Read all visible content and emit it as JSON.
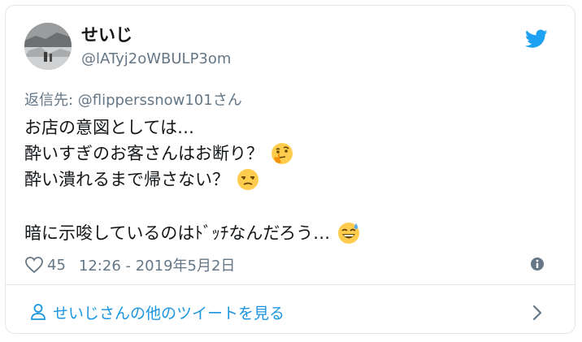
{
  "tweet": {
    "author": {
      "display_name": "せいじ",
      "handle": "@lATyj2oWBULP3om"
    },
    "reply_to": "返信先: @flipperssnow101さん",
    "lines": [
      "お店の意図としては…",
      "酔いすぎのお客さんはお断り？",
      "酔い潰れるまで帰さない？",
      "暗に示唆しているのはﾄﾞｯﾁなんだろう…"
    ],
    "emojis": {
      "line2": "thinking-face",
      "line3": "unamused-face",
      "line5": "grinning-sweat-face"
    },
    "likes": "45",
    "timestamp": "12:26 - 2019年5月2日",
    "more_link": "せいじさんの他のツイートを見る"
  },
  "colors": {
    "accent": "#1b95e0",
    "twitter_blue": "#1da1f2",
    "muted": "#657786",
    "border": "#e1e8ed"
  },
  "icons": {
    "brand": "twitter-bird-icon",
    "like": "heart-icon",
    "info": "info-icon",
    "person": "person-icon",
    "chevron": "chevron-right-icon"
  }
}
